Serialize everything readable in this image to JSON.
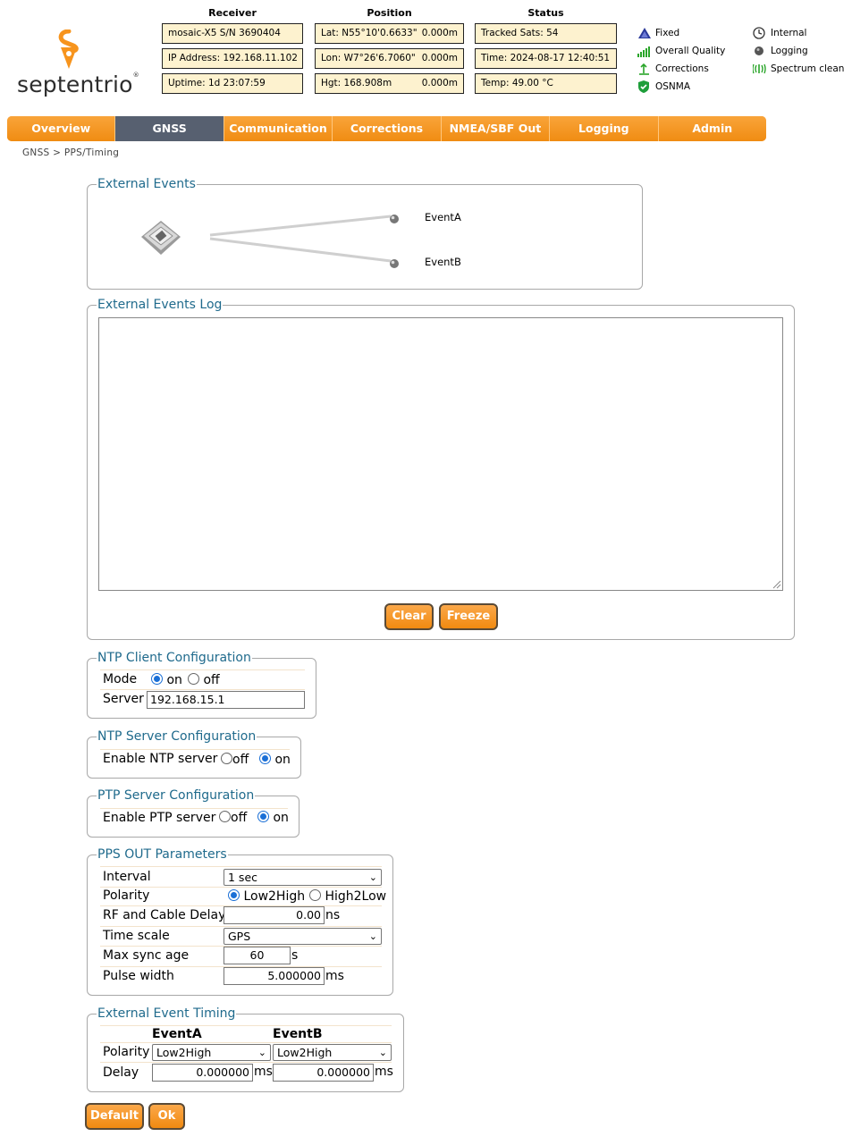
{
  "brand": {
    "name": "septentrio"
  },
  "columns": {
    "receiver": "Receiver",
    "position": "Position",
    "status": "Status"
  },
  "receiver": {
    "model": "mosaic-X5 S/N 3690404",
    "ip": "IP Address: 192.168.11.102",
    "uptime": "Uptime: 1d 23:07:59"
  },
  "position": {
    "lat": "Lat:  N55°10'0.6633\"",
    "lat_err": "0.000m",
    "lon": "Lon: W7°26'6.7060\"",
    "lon_err": "0.000m",
    "hgt": "Hgt: 168.908m",
    "hgt_err": "0.000m"
  },
  "status": {
    "sats": "Tracked Sats: 54",
    "time": "Time: 2024-08-17 12:40:51",
    "temp": "Temp: 49.00 °C"
  },
  "indicators": {
    "left": [
      "Fixed",
      "Overall Quality",
      "Corrections",
      "OSNMA"
    ],
    "right": [
      "Internal",
      "Logging",
      "Spectrum clean"
    ],
    "icons": [
      "fixed-icon",
      "signal-quality-icon",
      "corrections-icon",
      "osnma-shield-icon",
      "clock-icon",
      "logging-icon",
      "spectrum-icon"
    ]
  },
  "nav": {
    "tabs": [
      "Overview",
      "GNSS",
      "Communication",
      "Corrections",
      "NMEA/SBF Out",
      "Logging",
      "Admin"
    ],
    "active": "GNSS"
  },
  "breadcrumb": "GNSS > PPS/Timing",
  "external_events": {
    "legend": "External Events",
    "event_a": "EventA",
    "event_b": "EventB"
  },
  "events_log": {
    "legend": "External Events Log",
    "clear": "Clear",
    "freeze": "Freeze"
  },
  "ntp_client": {
    "legend": "NTP Client Configuration",
    "mode_label": "Mode",
    "on": "on",
    "off": "off",
    "mode_value": "on",
    "server_label": "Server",
    "server_value": "192.168.15.1"
  },
  "ntp_server": {
    "legend": "NTP Server Configuration",
    "label": "Enable NTP server",
    "off": "off",
    "on": "on",
    "value": "on"
  },
  "ptp_server": {
    "legend": "PTP Server Configuration",
    "label": "Enable PTP server",
    "off": "off",
    "on": "on",
    "value": "on"
  },
  "pps_out": {
    "legend": "PPS OUT Parameters",
    "interval_label": "Interval",
    "interval_value": "1 sec",
    "polarity_label": "Polarity",
    "low2high": "Low2High",
    "high2low": "High2Low",
    "polarity_value": "Low2High",
    "delay_label": "RF and Cable Delay",
    "delay_value": "0.00",
    "delay_unit": "ns",
    "timescale_label": "Time scale",
    "timescale_value": "GPS",
    "syncage_label": "Max sync age",
    "syncage_value": "60",
    "syncage_unit": "s",
    "pulse_label": "Pulse width",
    "pulse_value": "5.000000",
    "pulse_unit": "ms"
  },
  "event_timing": {
    "legend": "External Event Timing",
    "col_a": "EventA",
    "col_b": "EventB",
    "polarity_label": "Polarity",
    "polarity_a": "Low2High",
    "polarity_b": "Low2High",
    "delay_label": "Delay",
    "delay_a": "0.000000",
    "delay_b": "0.000000",
    "unit": "ms"
  },
  "actions": {
    "default": "Default",
    "ok": "Ok"
  },
  "colors": {
    "accent": "#f7941d",
    "nav_active": "#576070",
    "legend": "#1f6a8c",
    "info_bg": "#fdf2cf"
  }
}
